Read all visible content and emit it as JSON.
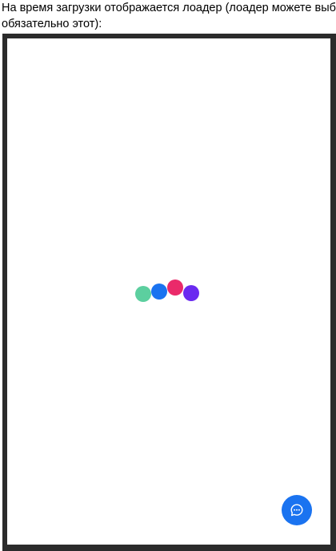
{
  "caption": {
    "line1": "На время загрузки отображается лоадер (лоадер можете выб",
    "line2": "обязательно этот):"
  },
  "loader": {
    "dots": [
      {
        "name": "loader-dot-green",
        "color": "#5ccf9f"
      },
      {
        "name": "loader-dot-blue",
        "color": "#1a73f0"
      },
      {
        "name": "loader-dot-pink",
        "color": "#ea2a6a"
      },
      {
        "name": "loader-dot-purple",
        "color": "#6a2af0"
      }
    ]
  },
  "chat_button": {
    "icon": "chat-bubble-icon",
    "color": "#1a73f0"
  }
}
